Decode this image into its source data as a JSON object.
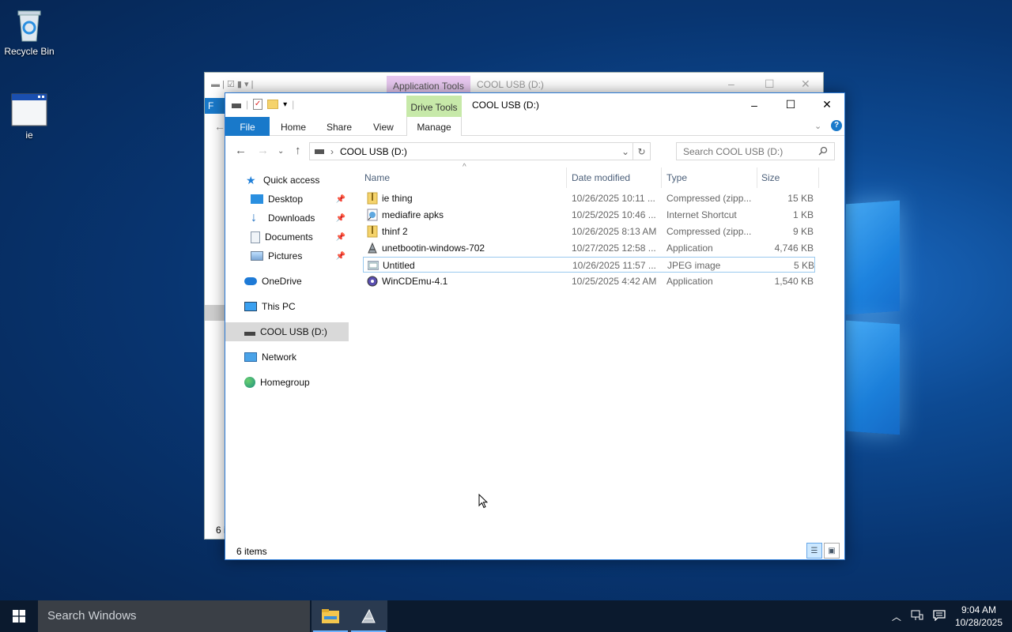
{
  "desktop": {
    "icons": [
      {
        "label": "Recycle Bin",
        "icon": "recycle-bin-icon"
      },
      {
        "label": "ie",
        "icon": "app-window-icon"
      }
    ]
  },
  "back_window": {
    "context_tab": "Application Tools",
    "title": "COOL USB (D:)",
    "ribbon_file_initial": "F",
    "status_partial": "6 i"
  },
  "window": {
    "title": "COOL USB (D:)",
    "context_tab": "Drive Tools",
    "ribbon_tabs": [
      "File",
      "Home",
      "Share",
      "View",
      "Manage"
    ],
    "address": {
      "location": "COOL USB (D:)"
    },
    "search": {
      "placeholder": "Search COOL USB (D:)"
    },
    "nav": [
      {
        "label": "Quick access",
        "icon": "star-icon"
      },
      {
        "label": "Desktop",
        "icon": "desktop-icon",
        "pinned": true
      },
      {
        "label": "Downloads",
        "icon": "download-icon",
        "pinned": true
      },
      {
        "label": "Documents",
        "icon": "documents-icon",
        "pinned": true
      },
      {
        "label": "Pictures",
        "icon": "pictures-icon",
        "pinned": true
      },
      {
        "label": "OneDrive",
        "icon": "cloud-icon"
      },
      {
        "label": "This PC",
        "icon": "computer-icon"
      },
      {
        "label": "COOL USB (D:)",
        "icon": "usb-drive-icon",
        "selected": true
      },
      {
        "label": "Network",
        "icon": "network-icon"
      },
      {
        "label": "Homegroup",
        "icon": "homegroup-icon"
      }
    ],
    "columns": {
      "name": "Name",
      "date": "Date modified",
      "type": "Type",
      "size": "Size"
    },
    "files": [
      {
        "name": "ie thing",
        "date": "10/26/2025 10:11 ...",
        "type": "Compressed (zipp...",
        "size": "15 KB",
        "icon": "zip-folder-icon"
      },
      {
        "name": "mediafire apks",
        "date": "10/25/2025 10:46 ...",
        "type": "Internet Shortcut",
        "size": "1 KB",
        "icon": "internet-shortcut-icon"
      },
      {
        "name": "thinf 2",
        "date": "10/26/2025 8:13 AM",
        "type": "Compressed (zipp...",
        "size": "9 KB",
        "icon": "zip-folder-icon"
      },
      {
        "name": "unetbootin-windows-702",
        "date": "10/27/2025 12:58 ...",
        "type": "Application",
        "size": "4,746 KB",
        "icon": "application-icon"
      },
      {
        "name": "Untitled",
        "date": "10/26/2025 11:57 ...",
        "type": "JPEG image",
        "size": "5 KB",
        "icon": "image-file-icon",
        "selected": true
      },
      {
        "name": "WinCDEmu-4.1",
        "date": "10/25/2025 4:42 AM",
        "type": "Application",
        "size": "1,540 KB",
        "icon": "application-icon"
      }
    ],
    "status": "6 items"
  },
  "taskbar": {
    "search_placeholder": "Search Windows",
    "time": "9:04 AM",
    "date": "10/28/2025"
  },
  "colors": {
    "accent": "#1979ca",
    "drive_tools": "#c7e9a9",
    "app_tools": "#e8c8f0"
  }
}
